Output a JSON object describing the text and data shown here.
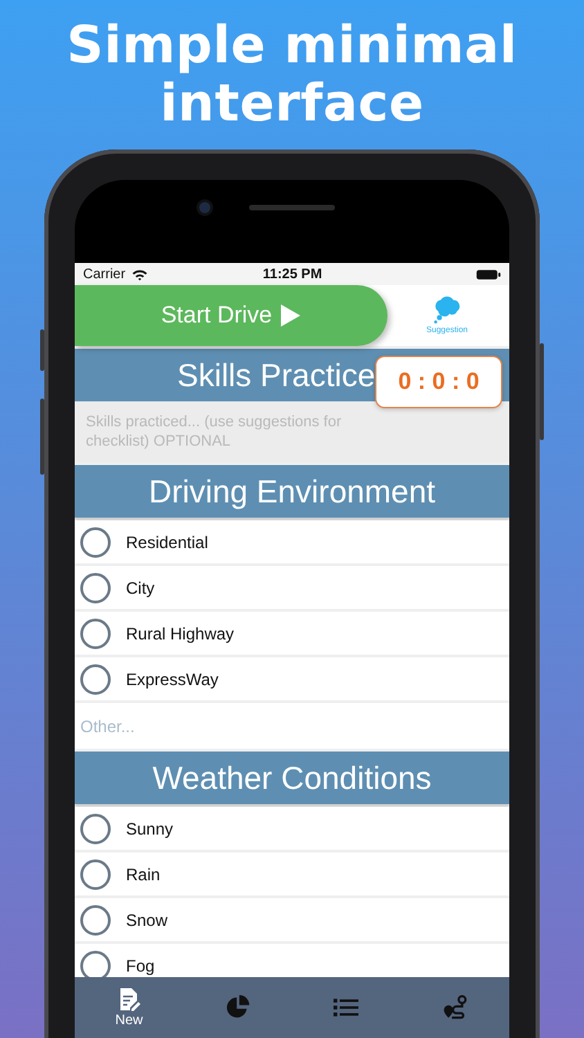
{
  "headline": "Simple minimal interface",
  "status_bar": {
    "carrier": "Carrier",
    "time": "11:25 PM"
  },
  "start_button": {
    "label": "Start Drive"
  },
  "suggestion": {
    "label": "Suggestion"
  },
  "timer": "0 : 0 : 0",
  "skills": {
    "title": "Skills Practice",
    "placeholder": "Skills practiced... (use suggestions for checklist) OPTIONAL"
  },
  "sections": [
    {
      "title": "Driving Environment",
      "options": [
        {
          "label": "Residential",
          "checked": false
        },
        {
          "label": "City",
          "checked": false
        },
        {
          "label": "Rural Highway",
          "checked": false
        },
        {
          "label": "ExpressWay",
          "checked": false
        }
      ],
      "other_placeholder": "Other..."
    },
    {
      "title": "Weather Conditions",
      "options": [
        {
          "label": "Sunny",
          "checked": false
        },
        {
          "label": "Rain",
          "checked": false
        },
        {
          "label": "Snow",
          "checked": false
        },
        {
          "label": "Fog",
          "checked": false
        }
      ]
    }
  ],
  "tab_bar": [
    {
      "kind": "new",
      "label": "New",
      "selected": true
    },
    {
      "kind": "stats",
      "selected": false
    },
    {
      "kind": "list",
      "selected": false
    },
    {
      "kind": "route",
      "selected": false
    }
  ]
}
